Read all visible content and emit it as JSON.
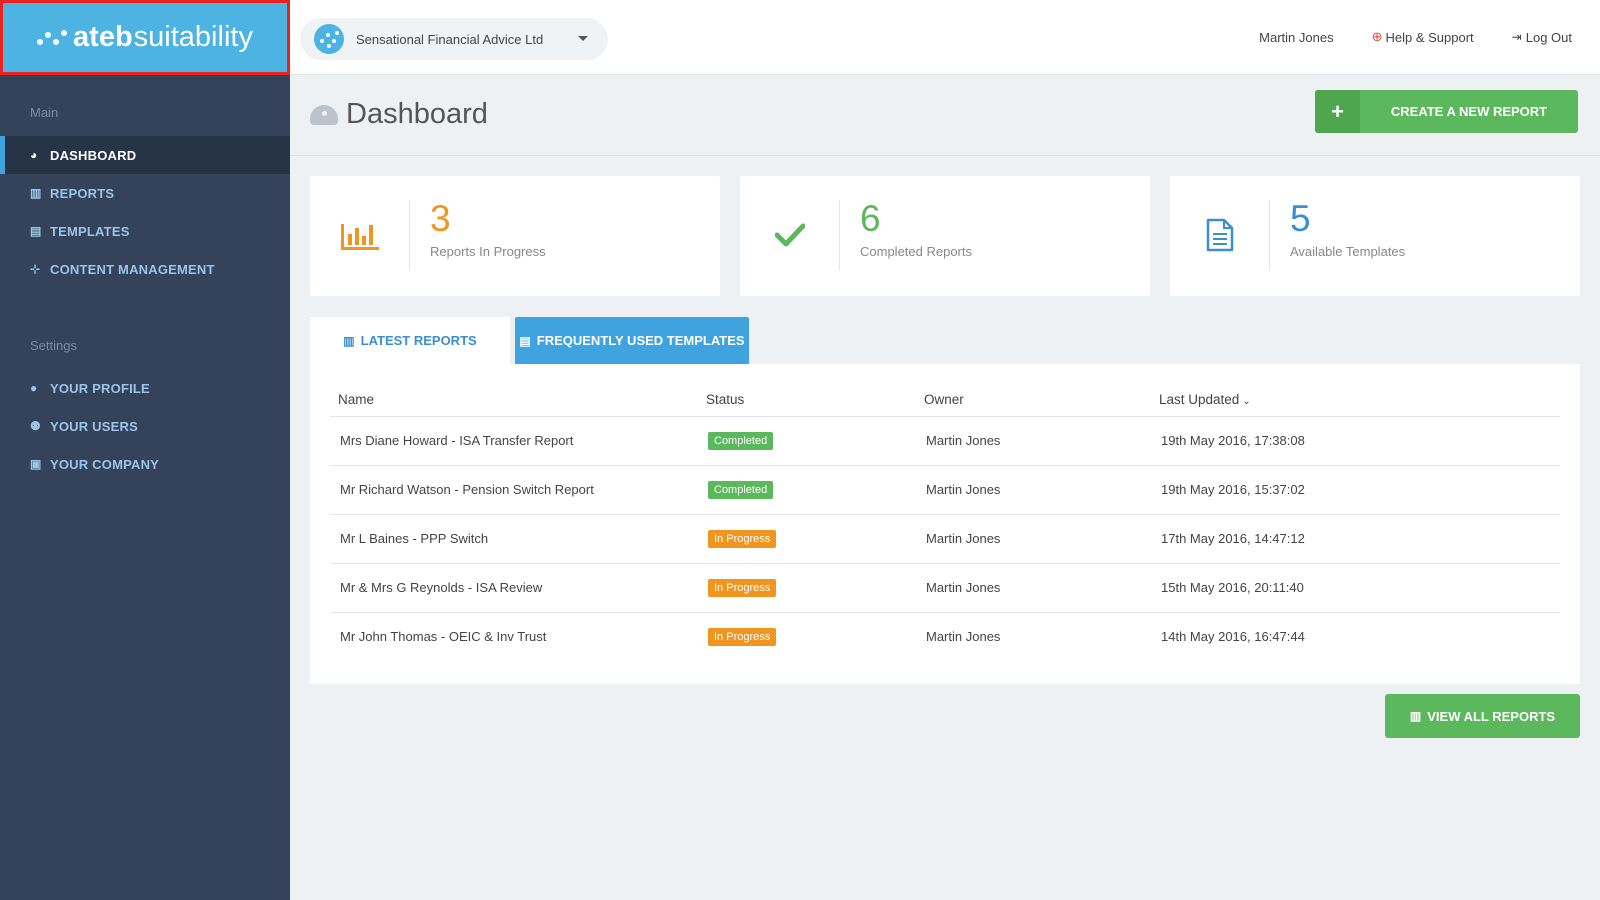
{
  "brand": {
    "bold": "ateb",
    "light": "suitability"
  },
  "header": {
    "company": "Sensational Financial Advice Ltd",
    "user": "Martin Jones",
    "help": "Help & Support",
    "logout": "Log Out"
  },
  "sidebar": {
    "main_label": "Main",
    "main_items": [
      {
        "label": "DASHBOARD",
        "icon": "dashboard-icon"
      },
      {
        "label": "REPORTS",
        "icon": "bar-chart-icon"
      },
      {
        "label": "TEMPLATES",
        "icon": "document-icon"
      },
      {
        "label": "CONTENT MANAGEMENT",
        "icon": "sitemap-icon"
      }
    ],
    "settings_label": "Settings",
    "settings_items": [
      {
        "label": "YOUR PROFILE",
        "icon": "user-icon"
      },
      {
        "label": "YOUR USERS",
        "icon": "users-icon"
      },
      {
        "label": "YOUR COMPANY",
        "icon": "briefcase-icon"
      }
    ]
  },
  "page": {
    "title": "Dashboard",
    "create_button": "CREATE A NEW REPORT"
  },
  "stats": [
    {
      "value": "3",
      "label": "Reports In Progress",
      "color": "#f0951f",
      "icon": "bar-chart-icon"
    },
    {
      "value": "6",
      "label": "Completed Reports",
      "color": "#5cb85c",
      "icon": "check-icon"
    },
    {
      "value": "5",
      "label": "Available Templates",
      "color": "#3a8fd2",
      "icon": "document-icon"
    }
  ],
  "tabs": {
    "latest": "LATEST REPORTS",
    "frequent": "FREQUENTLY USED TEMPLATES"
  },
  "table": {
    "columns": [
      "Name",
      "Status",
      "Owner",
      "Last Updated"
    ],
    "rows": [
      {
        "name": "Mrs Diane Howard - ISA Transfer Report",
        "status": "Completed",
        "owner": "Martin Jones",
        "updated": "19th May 2016, 17:38:08"
      },
      {
        "name": "Mr Richard Watson - Pension Switch Report",
        "status": "Completed",
        "owner": "Martin Jones",
        "updated": "19th May 2016, 15:37:02"
      },
      {
        "name": "Mr L Baines - PPP Switch",
        "status": "In Progress",
        "owner": "Martin Jones",
        "updated": "17th May 2016, 14:47:12"
      },
      {
        "name": "Mr & Mrs G Reynolds - ISA Review",
        "status": "In Progress",
        "owner": "Martin Jones",
        "updated": "15th May 2016, 20:11:40"
      },
      {
        "name": "Mr John Thomas - OEIC & Inv Trust",
        "status": "In Progress",
        "owner": "Martin Jones",
        "updated": "14th May 2016, 16:47:44"
      }
    ]
  },
  "view_all": "VIEW ALL REPORTS",
  "colors": {
    "accent": "#3ea3de",
    "success": "#5cb85c",
    "warning": "#f0951f",
    "sidebar": "#34425a",
    "brand": "#4cb3e3"
  }
}
